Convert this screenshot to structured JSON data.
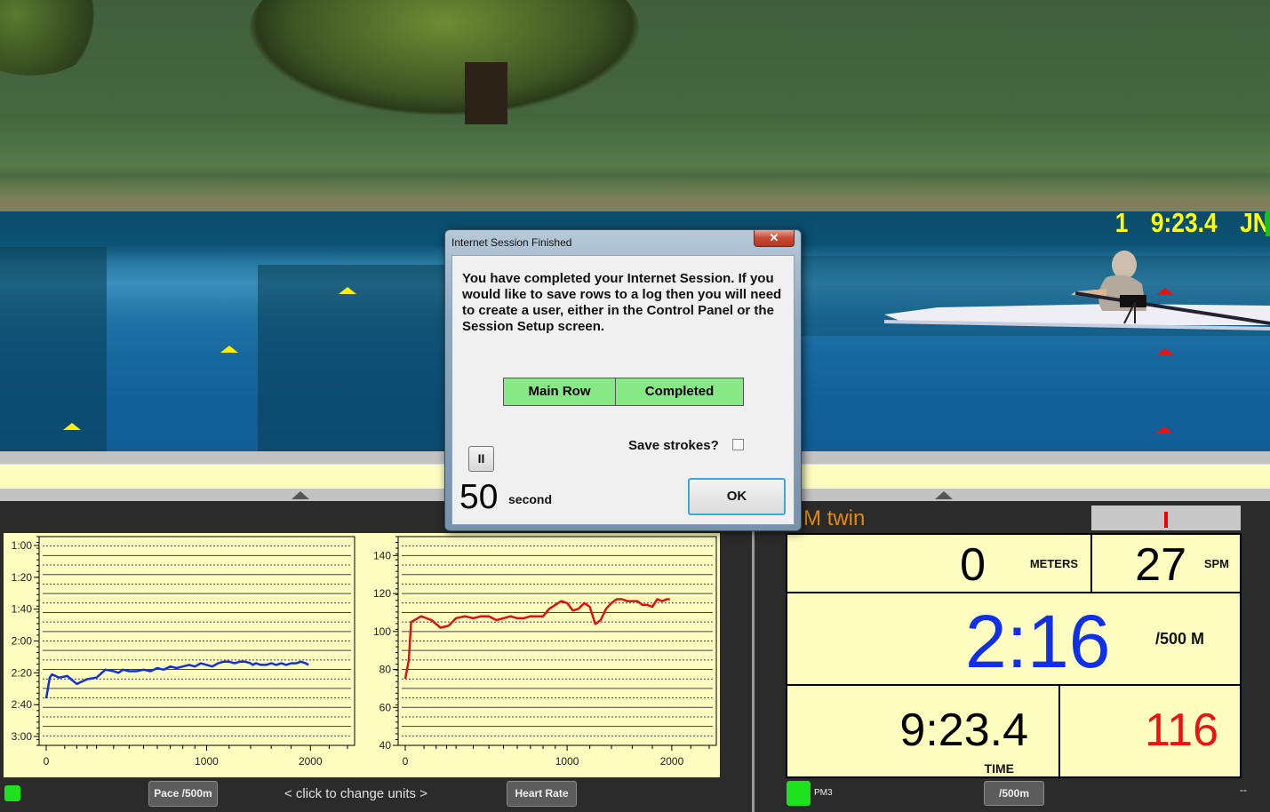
{
  "scene": {
    "race_info": {
      "place": "1",
      "time": "9:23.4",
      "initials": "JN"
    },
    "buoy_colors": {
      "left": "#ffee00",
      "right": "#ee1111"
    }
  },
  "dialog": {
    "title": "Internet Session Finished",
    "close_label": "✕",
    "message": "You have completed your Internet Session.  If you would like to save rows to a log then you will need to create a user, either in the Control Panel or the Session Setup screen.",
    "status_table": {
      "workout": "Main Row",
      "status": "Completed"
    },
    "save_strokes_label": "Save strokes?",
    "save_strokes_checked": false,
    "pause_label": "II",
    "countdown_value": "50",
    "countdown_unit": "second",
    "ok_label": "OK"
  },
  "left_panel": {
    "pace_button": "Pace /500m",
    "units_hint": "<  click to change units  >",
    "hr_button": "Heart Rate",
    "status_led": "#1ee21e"
  },
  "right_panel": {
    "title": "M twin",
    "force_indicator": "|",
    "meters_value": "0",
    "meters_label": "METERS",
    "spm_value": "27",
    "spm_label": "SPM",
    "pace_value": "2:16",
    "pace_label": "/500 M",
    "time_value": "9:23.4",
    "time_label": "TIME",
    "hr_value": "116",
    "monitor_label": "PM3",
    "units_button": "/500m",
    "right_status": "--",
    "colors": {
      "pace": "#1030e8",
      "hr": "#ee1111",
      "title": "#e38a10"
    }
  },
  "chart_data": [
    {
      "type": "line",
      "title": "Pace /500m",
      "xlabel": "",
      "ylabel": "",
      "x_tick_labels": [
        "0",
        "1000",
        "2000"
      ],
      "y_tick_labels": [
        "1:00",
        "1:20",
        "1:40",
        "2:00",
        "2:20",
        "2:40",
        "3:00"
      ],
      "ylim_seconds": [
        60,
        180
      ],
      "y_inverted": true,
      "xlim": [
        0,
        2400
      ],
      "grid": true,
      "color": "#1030e0",
      "series": [
        {
          "name": "Pace",
          "x": [
            0,
            5,
            10,
            30,
            60,
            100,
            150,
            200,
            250,
            300,
            330,
            360,
            400,
            450,
            500,
            550,
            600,
            650,
            700,
            750,
            800,
            850,
            900,
            950,
            1000,
            1050,
            1100,
            1150,
            1200,
            1250,
            1300,
            1350,
            1400,
            1420,
            1450,
            1500,
            1550,
            1600,
            1650,
            1700,
            1750,
            1800,
            1850,
            1900,
            1950,
            1980
          ],
          "y": [
            156,
            143,
            141,
            143,
            142,
            147,
            144,
            143,
            138,
            139,
            140,
            138,
            139,
            139,
            138,
            139,
            137,
            138,
            136,
            137,
            136,
            135,
            136,
            134,
            135,
            136,
            134,
            133,
            133,
            134,
            133,
            133,
            134,
            135,
            134,
            135,
            135,
            134,
            135,
            134,
            135,
            134,
            134,
            133,
            134,
            135
          ]
        }
      ]
    },
    {
      "type": "line",
      "title": "Heart Rate",
      "xlabel": "",
      "ylabel": "",
      "x_tick_labels": [
        "0",
        "1000",
        "2000"
      ],
      "y_tick_labels": [
        "40",
        "60",
        "80",
        "100",
        "120",
        "140"
      ],
      "ylim": [
        40,
        150
      ],
      "xlim": [
        0,
        2400
      ],
      "grid": true,
      "color": "#e01010",
      "series": [
        {
          "name": "Heart Rate",
          "x": [
            0,
            5,
            10,
            40,
            80,
            120,
            160,
            200,
            250,
            300,
            350,
            400,
            450,
            500,
            550,
            600,
            650,
            700,
            750,
            800,
            850,
            900,
            950,
            1000,
            1050,
            1100,
            1150,
            1200,
            1250,
            1300,
            1350,
            1400,
            1450,
            1500,
            1550,
            1600,
            1650,
            1700,
            1750,
            1800,
            1850,
            1900,
            1950,
            1980
          ],
          "y": [
            75,
            85,
            105,
            108,
            106,
            102,
            103,
            107,
            108,
            107,
            108,
            108,
            106,
            107,
            108,
            107,
            107,
            108,
            108,
            108,
            112,
            114,
            116,
            115,
            111,
            112,
            115,
            113,
            104,
            106,
            112,
            115,
            117,
            117,
            116,
            116,
            116,
            114,
            114,
            113,
            117,
            116,
            117,
            117
          ]
        }
      ]
    }
  ]
}
